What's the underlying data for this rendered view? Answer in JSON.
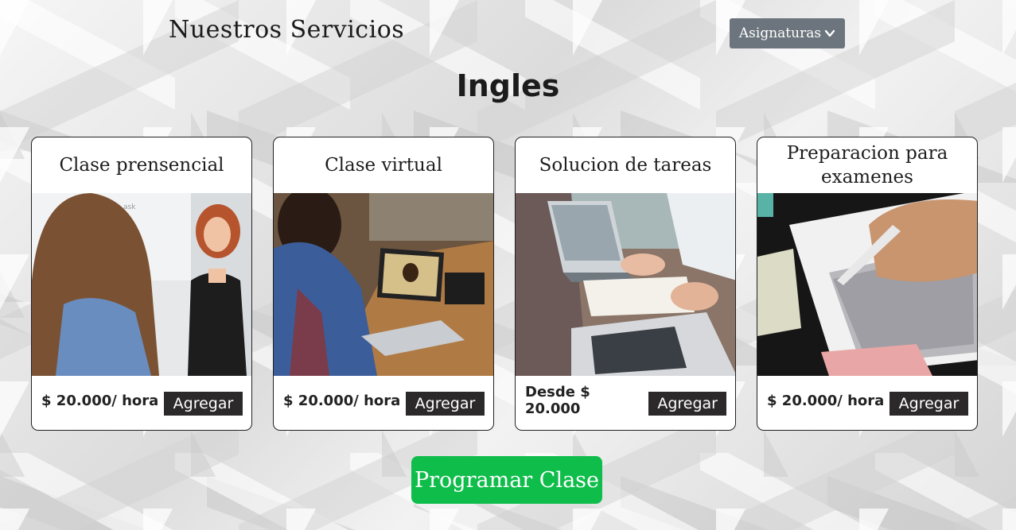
{
  "header": {
    "title": "Nuestros Servicios",
    "dropdown_label": "Asignaturas",
    "dropdown_icon": "chevron-down-icon"
  },
  "page_heading": "Ingles",
  "cards": [
    {
      "title": "Clase prensencial",
      "price": "$ 20.000/ hora",
      "button": "Agregar",
      "image": "teacher-whiteboard-photo"
    },
    {
      "title": "Clase virtual",
      "price": "$ 20.000/ hora",
      "button": "Agregar",
      "image": "video-call-laptop-photo"
    },
    {
      "title": "Solucion de tareas",
      "price": "Desde $ 20.000",
      "button": "Agregar",
      "image": "laptop-notes-photo"
    },
    {
      "title": "Preparacion para examenes",
      "price": "$ 20.000/ hora",
      "button": "Agregar",
      "image": "exam-answer-sheet-photo"
    }
  ],
  "cta": {
    "label": "Programar Clase",
    "color": "#0fbd4a"
  },
  "colors": {
    "dropdown_bg": "#6c757d",
    "button_bg": "#2b2929"
  }
}
